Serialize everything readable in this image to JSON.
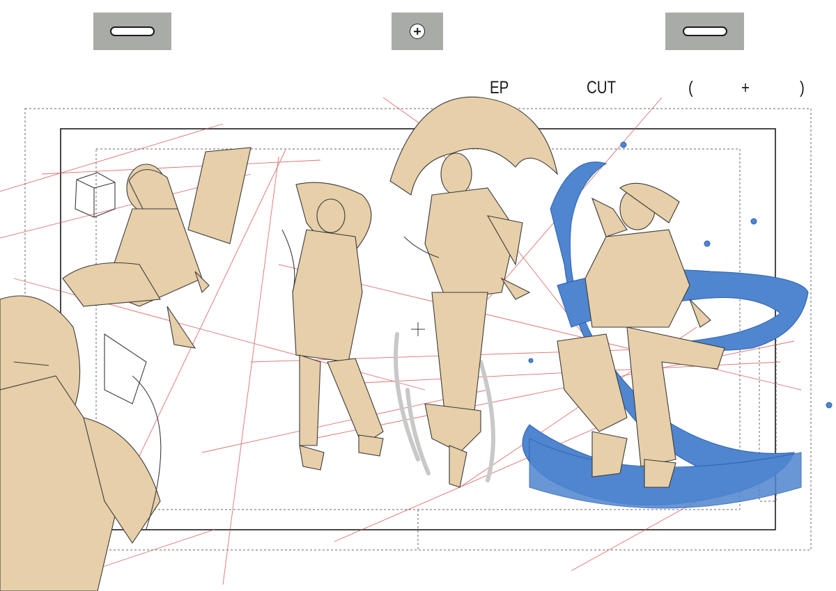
{
  "sheet": {
    "ep_label": "EP",
    "cut_label": "CUT",
    "time_open": "(",
    "time_plus": "+",
    "time_close": ")"
  },
  "colors": {
    "peg_tab": "#a9aca6",
    "skin_tone": "#e6cfa9",
    "water_blue": "#4f86cf",
    "guide_red": "#d94a4a",
    "line_dark": "#3a3a3a"
  },
  "icons": [
    "peg-slot-icon",
    "peg-hole-icon",
    "peg-slot-icon",
    "center-crosshair-icon"
  ]
}
